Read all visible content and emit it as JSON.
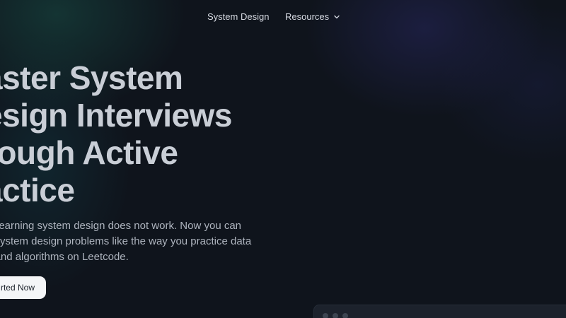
{
  "nav": {
    "system_design": "System Design",
    "resources": "Resources",
    "resources_icon": "chevron-down-icon"
  },
  "hero": {
    "title_lines": [
      "aster System",
      "esign Interviews",
      "rough Active",
      "actice"
    ],
    "subtitle_lines": [
      "ly learning system design does not work. Now you can",
      "e system design problems like the way you practice data",
      "e and algorithms on Leetcode."
    ],
    "cta_label": "rted Now"
  },
  "colors": {
    "background": "#0f141c",
    "title": "#c9ced6",
    "subtitle": "#aeb4be",
    "cta_bg": "#f4f5f7",
    "cta_text": "#1c222b"
  }
}
